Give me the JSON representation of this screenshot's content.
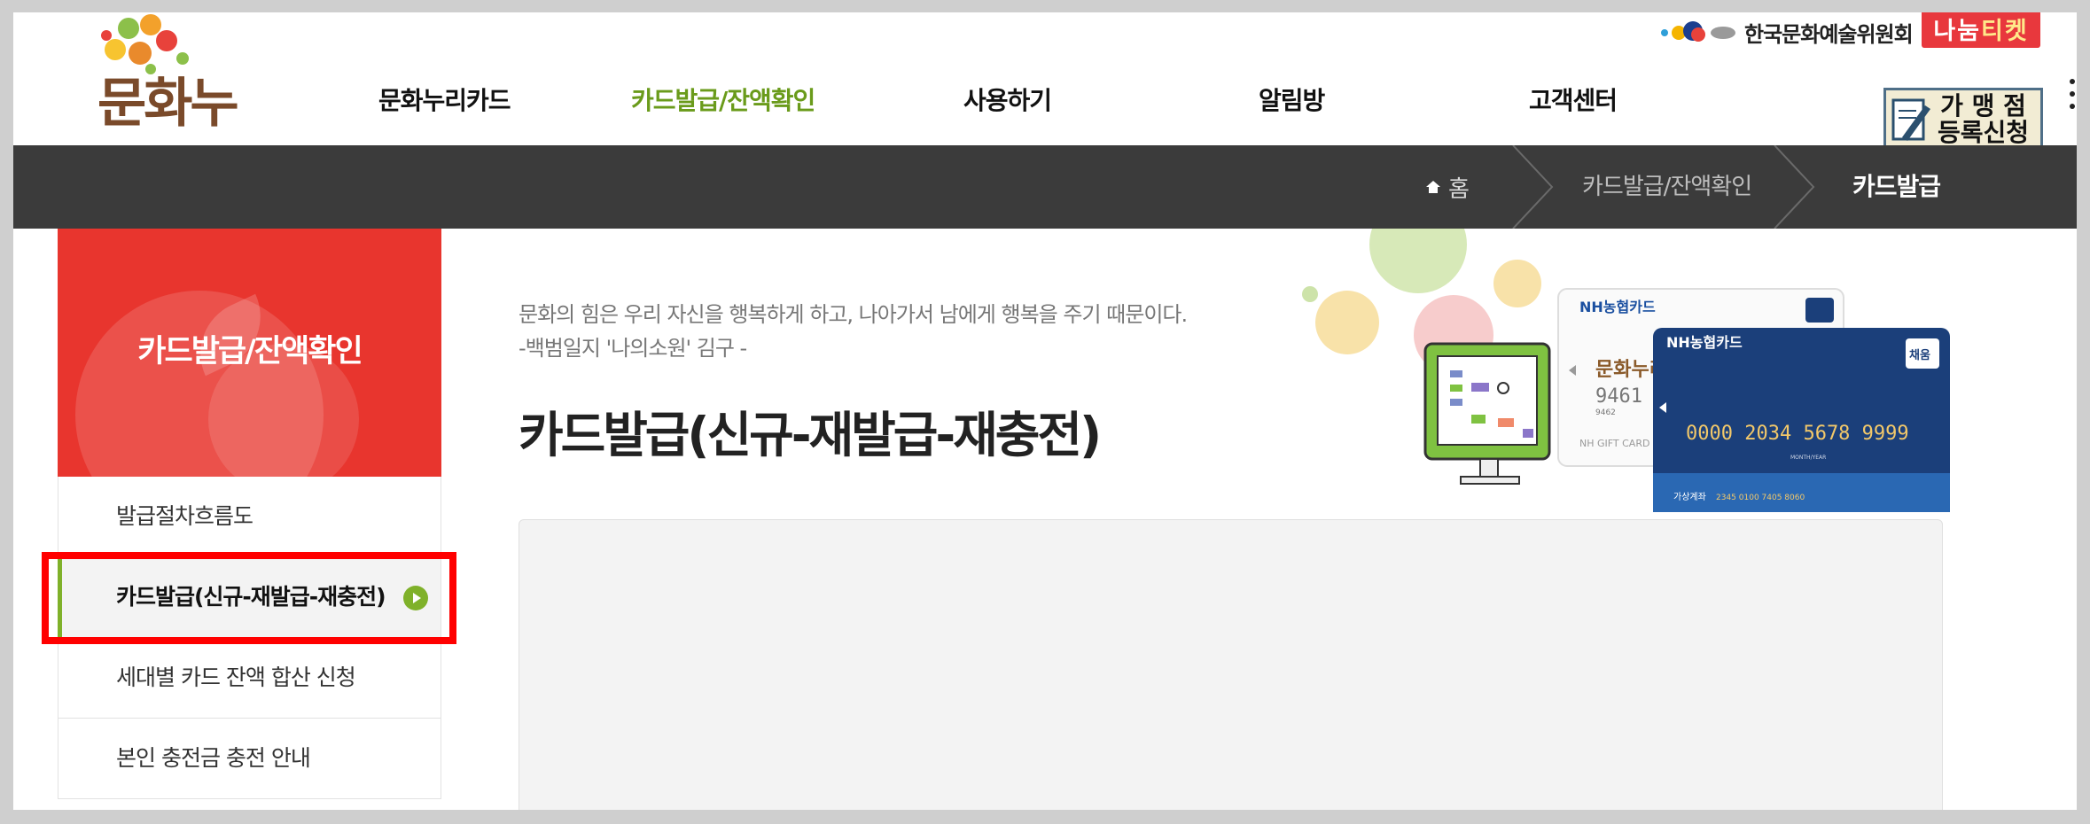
{
  "header": {
    "logo_text": "문화누리",
    "org_name": "한국문화예술위원회",
    "nanum_ticket_a": "나눔",
    "nanum_ticket_b": "티켓",
    "merchant_line1": "가 맹 점",
    "merchant_line2": "등록신청"
  },
  "nav": {
    "items": [
      {
        "label": "문화누리카드",
        "active": false
      },
      {
        "label": "카드발급/잔액확인",
        "active": true
      },
      {
        "label": "사용하기",
        "active": false
      },
      {
        "label": "알림방",
        "active": false
      },
      {
        "label": "고객센터",
        "active": false
      }
    ]
  },
  "breadcrumb": {
    "home": "홈",
    "section": "카드발급/잔액확인",
    "current": "카드발급"
  },
  "sidebar": {
    "title": "카드발급/잔액확인",
    "items": [
      {
        "label": "발급절차흐름도",
        "active": false
      },
      {
        "label": "카드발급(신규-재발급-재충전)",
        "active": true
      },
      {
        "label": "세대별 카드 잔액 합산 신청",
        "active": false
      },
      {
        "label": "본인 충전금 충전 안내",
        "active": false
      }
    ]
  },
  "main": {
    "quote_line1": "문화의 힘은 우리 자신을 행복하게 하고, 나아가서 남에게 행복을 주기 때문이다.",
    "quote_line2": "-백범일지 '나의소원' 김구 -",
    "title": "카드발급(신규-재발급-재충전)"
  },
  "hero": {
    "card_brand": "NH농협카드",
    "card_badge": "채움",
    "card_number": "0000 2034 5678 9999",
    "card_expiry_label": "MONTH/YEAR",
    "card_account_label": "가상계좌",
    "card_account_number": "2345 0100 7405 8060",
    "white_card_brand": "NH농협카드",
    "white_card_logo": "문화누리",
    "white_card_number": "9461",
    "white_card_sub": "9462",
    "white_card_footer": "NH GIFT CARD"
  },
  "colors": {
    "accent_green": "#6a9b1b",
    "sidebar_red": "#e8352e",
    "breadcrumb_bg": "#3b3b3b",
    "highlight_red": "#ff0000"
  }
}
